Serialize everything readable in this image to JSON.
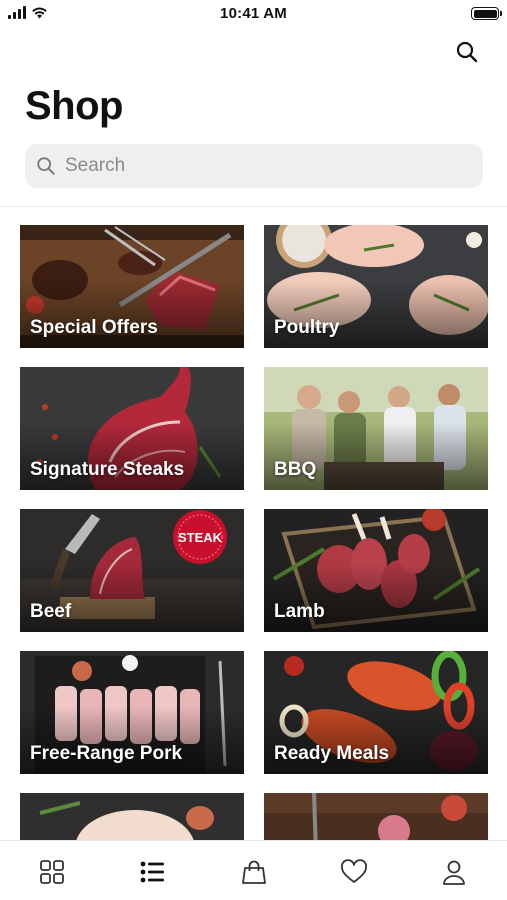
{
  "status_bar": {
    "time": "10:41 AM"
  },
  "header": {
    "title": "Shop"
  },
  "search": {
    "placeholder": "Search"
  },
  "categories": [
    {
      "label": "Special Offers"
    },
    {
      "label": "Poultry"
    },
    {
      "label": "Signature Steaks"
    },
    {
      "label": "BBQ"
    },
    {
      "label": "Beef"
    },
    {
      "label": "Lamb"
    },
    {
      "label": "Free-Range Pork"
    },
    {
      "label": "Ready Meals"
    },
    {
      "label": ""
    },
    {
      "label": ""
    }
  ],
  "badges": {
    "steak_stamp": "STEAK"
  },
  "nav": {
    "items": [
      {
        "icon": "grid-icon",
        "active": false
      },
      {
        "icon": "list-icon",
        "active": true
      },
      {
        "icon": "shopping-bag-icon",
        "active": false
      },
      {
        "icon": "heart-icon",
        "active": false
      },
      {
        "icon": "profile-icon",
        "active": false
      }
    ]
  },
  "colors": {
    "accent": "#111111",
    "search_bg": "#efefef",
    "stamp_red": "#c8102e"
  }
}
